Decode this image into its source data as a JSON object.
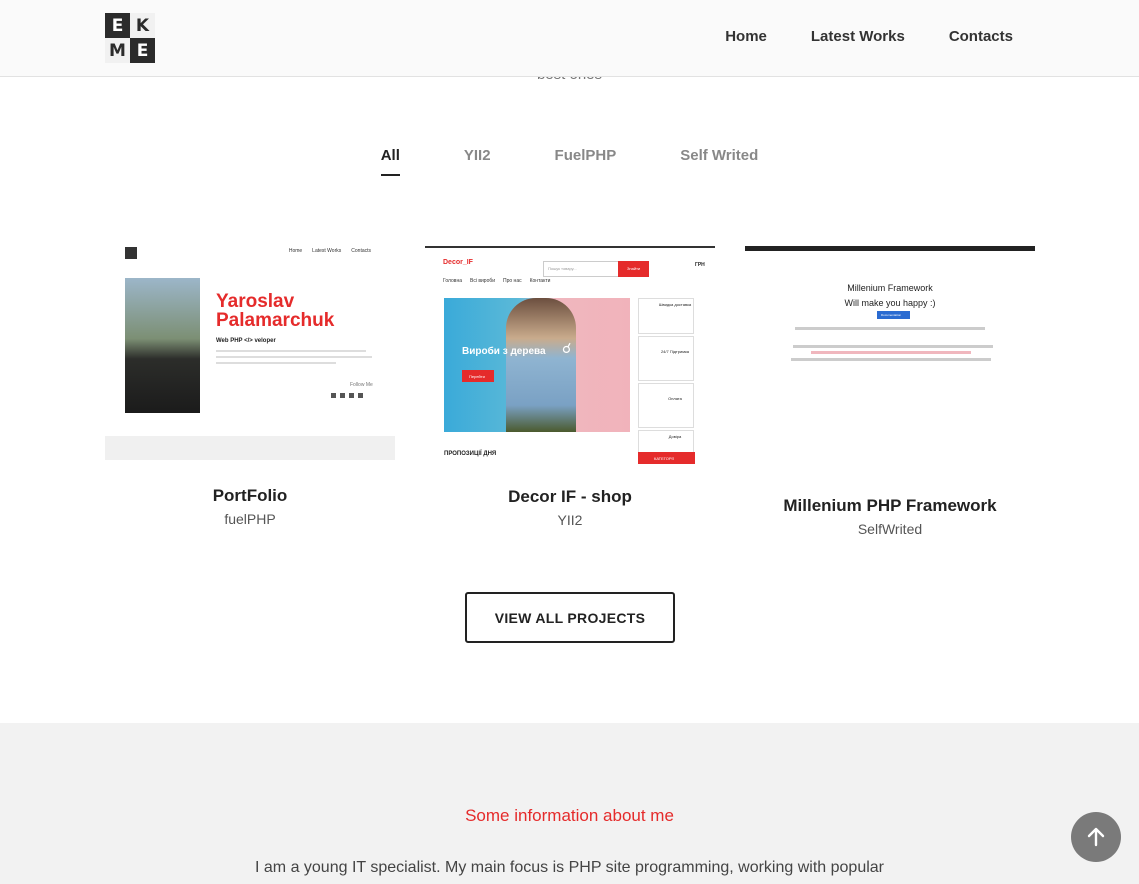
{
  "header": {
    "logo": [
      "E",
      "K",
      "M",
      "E"
    ],
    "nav": [
      "Home",
      "Latest Works",
      "Contacts"
    ]
  },
  "intro": {
    "subtitle_tail": "best ones"
  },
  "filters": {
    "items": [
      "All",
      "YII2",
      "FuelPHP",
      "Self Writed"
    ],
    "active": "All"
  },
  "projects": [
    {
      "title": "PortFolio",
      "tag": "fuelPHP",
      "preview": {
        "nav": [
          "Home",
          "Latest Works",
          "Contacts"
        ],
        "name": "Yaroslav Palamarchuk",
        "role": "Web PHP </> veloper",
        "follow": "Follow Me"
      }
    },
    {
      "title": "Decor IF - shop",
      "tag": "YII2",
      "preview": {
        "brand": "Decor_IF",
        "search_placeholder": "Пошук товару...",
        "search_button": "Знайти",
        "currency": "ГРН",
        "menu": [
          "Головна",
          "Всі вироби",
          "Про нас",
          "Контакти"
        ],
        "hero_title": "Вироби з дерева",
        "hero_button": "Перейти",
        "side": [
          "Швидка доставка",
          "24/7 Підтримка",
          "Оплата",
          "Довіра"
        ],
        "promo": "ПРОПОЗИЦІЇ ДНЯ",
        "categories": "КАТЕГОРІЇ"
      }
    },
    {
      "title": "Millenium PHP Framework",
      "tag": "SelfWrited",
      "preview": {
        "heading": "Millenium Framework",
        "subheading": "Will make you happy :)",
        "button": "Documentation"
      }
    }
  ],
  "cta": {
    "label": "VIEW ALL PROJECTS"
  },
  "about": {
    "title": "Some information about me",
    "text": "I am a young IT specialist. My main focus is PHP site programming, working with popular"
  },
  "colors": {
    "accent": "#e52b2b",
    "dark": "#222222",
    "about_bg": "#f2f2f2"
  },
  "icons": {
    "scroll_top": "arrow-up-icon"
  }
}
